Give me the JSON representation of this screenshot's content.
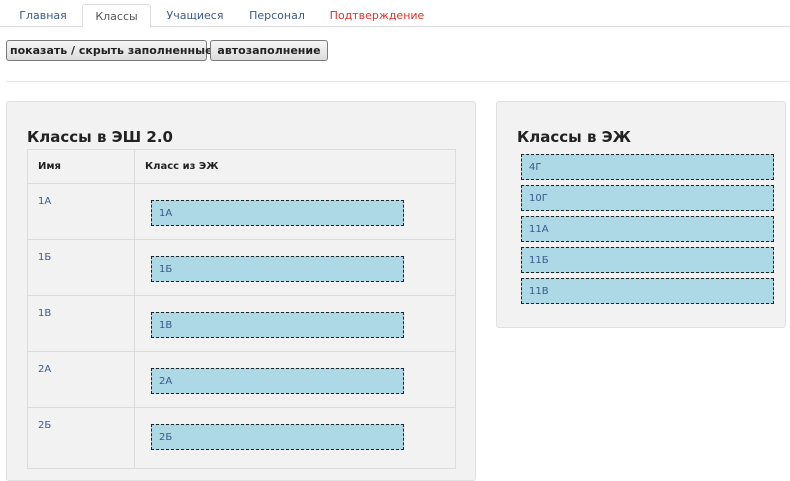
{
  "tabs": [
    {
      "label": "Главная",
      "active": false,
      "alert": false
    },
    {
      "label": "Классы",
      "active": true,
      "alert": false
    },
    {
      "label": "Учащиеся",
      "active": false,
      "alert": false
    },
    {
      "label": "Персонал",
      "active": false,
      "alert": false
    },
    {
      "label": "Подтверждение",
      "active": false,
      "alert": true
    }
  ],
  "toolbar": {
    "toggle_filled_label": "показать / скрыть заполненные",
    "autofill_label": "автозаполнение"
  },
  "esh_panel": {
    "title": "Классы в ЭШ 2.0",
    "columns": {
      "name": "Имя",
      "ej_class": "Класс из ЭЖ"
    },
    "rows": [
      {
        "name": "1А",
        "ej_class": "1А"
      },
      {
        "name": "1Б",
        "ej_class": "1Б"
      },
      {
        "name": "1В",
        "ej_class": "1В"
      },
      {
        "name": "2А",
        "ej_class": "2А"
      },
      {
        "name": "2Б",
        "ej_class": "2Б"
      }
    ]
  },
  "ej_panel": {
    "title": "Классы в ЭЖ",
    "items": [
      "4Г",
      "10Г",
      "11А",
      "11Б",
      "11В"
    ]
  },
  "colors": {
    "slot_fill": "#add8e6",
    "alert_tab": "#e0302a",
    "link_text": "#3a5a8a"
  }
}
